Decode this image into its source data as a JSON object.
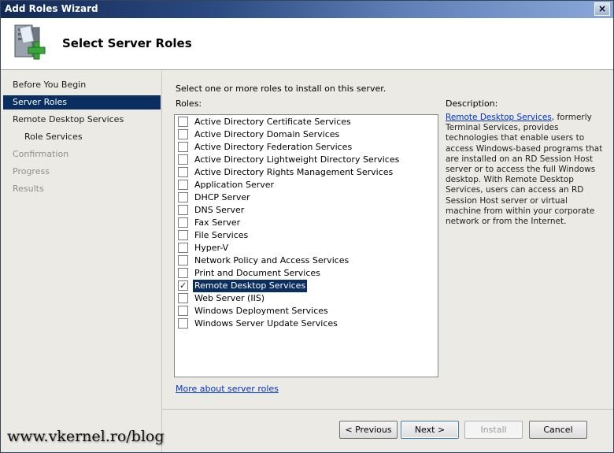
{
  "window": {
    "title": "Add Roles Wizard",
    "close_symbol": "×"
  },
  "header": {
    "title": "Select Server Roles",
    "icon": "server-add-icon"
  },
  "sidebar": {
    "items": [
      {
        "label": "Before You Begin",
        "state": "normal"
      },
      {
        "label": "Server Roles",
        "state": "active"
      },
      {
        "label": "Remote Desktop Services",
        "state": "normal"
      },
      {
        "label": "Role Services",
        "state": "sub"
      },
      {
        "label": "Confirmation",
        "state": "disabled"
      },
      {
        "label": "Progress",
        "state": "disabled"
      },
      {
        "label": "Results",
        "state": "disabled"
      }
    ]
  },
  "main": {
    "intro": "Select one or more roles to install on this server.",
    "roles_label": "Roles:",
    "roles": [
      {
        "label": "Active Directory Certificate Services",
        "checked": false
      },
      {
        "label": "Active Directory Domain Services",
        "checked": false
      },
      {
        "label": "Active Directory Federation Services",
        "checked": false
      },
      {
        "label": "Active Directory Lightweight Directory Services",
        "checked": false
      },
      {
        "label": "Active Directory Rights Management Services",
        "checked": false
      },
      {
        "label": "Application Server",
        "checked": false
      },
      {
        "label": "DHCP Server",
        "checked": false
      },
      {
        "label": "DNS Server",
        "checked": false
      },
      {
        "label": "Fax Server",
        "checked": false
      },
      {
        "label": "File Services",
        "checked": false
      },
      {
        "label": "Hyper-V",
        "checked": false
      },
      {
        "label": "Network Policy and Access Services",
        "checked": false
      },
      {
        "label": "Print and Document Services",
        "checked": false
      },
      {
        "label": "Remote Desktop Services",
        "checked": true,
        "selected": true
      },
      {
        "label": "Web Server (IIS)",
        "checked": false
      },
      {
        "label": "Windows Deployment Services",
        "checked": false
      },
      {
        "label": "Windows Server Update Services",
        "checked": false
      }
    ],
    "description_label": "Description:",
    "description_link": "Remote Desktop Services",
    "description_text": ", formerly Terminal Services, provides technologies that enable users to access Windows-based programs that are installed on an RD Session Host server or to access the full Windows desktop. With Remote Desktop Services, users can access an RD Session Host server or virtual machine from within your corporate network or from the Internet.",
    "more_link": "More about server roles"
  },
  "buttons": {
    "previous": "< Previous",
    "next": "Next >",
    "install": "Install",
    "cancel": "Cancel"
  },
  "watermark": "www.vkernel.ro/blog",
  "colors": {
    "selection": "#0a2e60",
    "panel": "#eceae4",
    "link": "#0033cc"
  }
}
